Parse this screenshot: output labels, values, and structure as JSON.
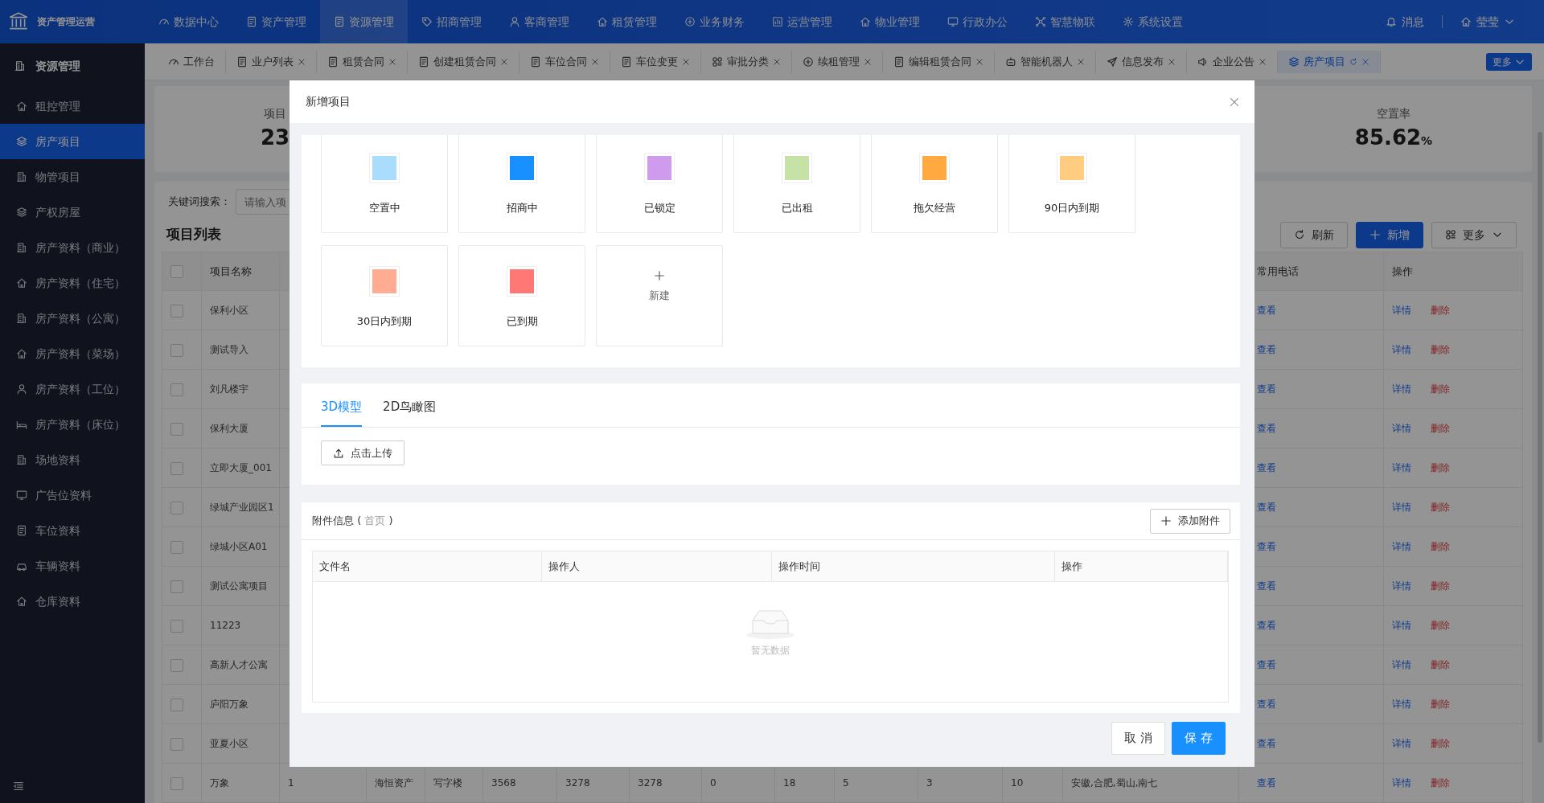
{
  "app": {
    "title": "资产管理运营"
  },
  "top_menu": [
    {
      "label": "数据中心",
      "selected": false
    },
    {
      "label": "资产管理",
      "selected": false
    },
    {
      "label": "资源管理",
      "selected": true
    },
    {
      "label": "招商管理",
      "selected": false
    },
    {
      "label": "客商管理",
      "selected": false
    },
    {
      "label": "租赁管理",
      "selected": false
    },
    {
      "label": "业务财务",
      "selected": false
    },
    {
      "label": "运营管理",
      "selected": false
    },
    {
      "label": "物业管理",
      "selected": false
    },
    {
      "label": "行政办公",
      "selected": false
    },
    {
      "label": "智慧物联",
      "selected": false
    },
    {
      "label": "系统设置",
      "selected": false
    }
  ],
  "header_right": {
    "messages": "消息",
    "user": "莹莹"
  },
  "sidebar": {
    "title": "资源管理",
    "items": [
      {
        "label": "租控管理",
        "selected": false
      },
      {
        "label": "房产项目",
        "selected": true
      },
      {
        "label": "物管项目",
        "selected": false
      },
      {
        "label": "产权房屋",
        "selected": false
      },
      {
        "label": "房产资料（商业）",
        "selected": false
      },
      {
        "label": "房产资料（住宅）",
        "selected": false
      },
      {
        "label": "房产资料（公寓）",
        "selected": false
      },
      {
        "label": "房产资料（菜场）",
        "selected": false
      },
      {
        "label": "房产资料（工位）",
        "selected": false
      },
      {
        "label": "房产资料（床位）",
        "selected": false
      },
      {
        "label": "场地资料",
        "selected": false
      },
      {
        "label": "广告位资料",
        "selected": false
      },
      {
        "label": "车位资料",
        "selected": false
      },
      {
        "label": "车辆资料",
        "selected": false
      },
      {
        "label": "仓库资料",
        "selected": false
      }
    ]
  },
  "tabs": [
    {
      "label": "工作台",
      "closable": false,
      "selected": false
    },
    {
      "label": "业户列表",
      "closable": true,
      "selected": false
    },
    {
      "label": "租赁合同",
      "closable": true,
      "selected": false
    },
    {
      "label": "创建租赁合同",
      "closable": true,
      "selected": false
    },
    {
      "label": "车位合同",
      "closable": true,
      "selected": false
    },
    {
      "label": "车位变更",
      "closable": true,
      "selected": false
    },
    {
      "label": "审批分类",
      "closable": true,
      "selected": false
    },
    {
      "label": "续租管理",
      "closable": true,
      "selected": false
    },
    {
      "label": "编辑租赁合同",
      "closable": true,
      "selected": false
    },
    {
      "label": "智能机器人",
      "closable": true,
      "selected": false
    },
    {
      "label": "信息发布",
      "closable": true,
      "selected": false
    },
    {
      "label": "企业公告",
      "closable": true,
      "selected": false
    },
    {
      "label": "房产项目",
      "closable": true,
      "selected": true
    }
  ],
  "tabs_more": "更多",
  "stats": [
    {
      "label": "项目",
      "value": "23"
    },
    {
      "label": "空置率",
      "value": "85.62",
      "unit": "%"
    }
  ],
  "search": {
    "label": "关键词搜索：",
    "placeholder": "请输入项"
  },
  "list": {
    "title": "项目列表",
    "buttons": [
      {
        "label": "刷新",
        "kind": "refresh"
      },
      {
        "label": "新增",
        "kind": "primary"
      },
      {
        "label": "更多",
        "kind": "more"
      }
    ]
  },
  "table": {
    "header_checked": false,
    "columns": [
      {
        "label": "项目名称"
      },
      {
        "label": "常用电话"
      },
      {
        "label": "操作"
      }
    ],
    "rows": [
      {
        "checked": false,
        "name": "保利小区",
        "link": "查看",
        "actions": [
          "详情",
          "删除"
        ]
      },
      {
        "checked": false,
        "name": "测试导入",
        "link": "查看",
        "actions": [
          "详情",
          "删除"
        ]
      },
      {
        "checked": false,
        "name": "刘凡楼宇",
        "link": "查看",
        "actions": [
          "详情",
          "删除"
        ]
      },
      {
        "checked": false,
        "name": "保利大厦",
        "link": "查看",
        "actions": [
          "详情",
          "删除"
        ]
      },
      {
        "checked": false,
        "name": "立即大厦_001",
        "link": "查看",
        "actions": [
          "详情",
          "删除"
        ]
      },
      {
        "checked": false,
        "name": "绿城产业园区1",
        "link": "查看",
        "actions": [
          "详情",
          "删除"
        ]
      },
      {
        "checked": false,
        "name": "绿城小区A01",
        "link": "查看",
        "actions": [
          "详情",
          "删除"
        ]
      },
      {
        "checked": false,
        "name": "测试公寓项目",
        "link": "查看",
        "actions": [
          "详情",
          "删除"
        ]
      },
      {
        "checked": false,
        "name": "11223",
        "link": "查看",
        "actions": [
          "详情",
          "删除"
        ]
      },
      {
        "checked": false,
        "name": "高新人才公寓",
        "link": "查看",
        "actions": [
          "详情",
          "删除"
        ]
      },
      {
        "checked": false,
        "name": "庐阳万象",
        "link": "查看",
        "actions": [
          "详情",
          "删除"
        ]
      },
      {
        "checked": false,
        "name": "亚夏小区",
        "link": "查看",
        "actions": [
          "详情",
          "删除"
        ]
      },
      {
        "checked": false,
        "name": "万象",
        "details": [
          "1",
          "海恒资产",
          "写字楼",
          "3568",
          "3278",
          "3278",
          "0",
          "18",
          "5",
          "3",
          "10",
          "安徽,合肥,蜀山,南七"
        ],
        "link": "查看",
        "actions": [
          "详情",
          "删除"
        ]
      }
    ]
  },
  "modal": {
    "title": "新增项目",
    "statuses": [
      {
        "kind": "status",
        "label": "空置中",
        "color": "#a9dcfd"
      },
      {
        "kind": "status",
        "label": "招商中",
        "color": "#1890ff"
      },
      {
        "kind": "status",
        "label": "已锁定",
        "color": "#cf9bed"
      },
      {
        "kind": "status",
        "label": "已出租",
        "color": "#c7e2a6"
      },
      {
        "kind": "status",
        "label": "拖欠经营",
        "color": "#ffa940"
      },
      {
        "kind": "status",
        "label": "90日内到期",
        "color": "#ffcc80"
      },
      {
        "kind": "status",
        "label": "30日内到期",
        "color": "#ffac93"
      },
      {
        "kind": "status",
        "label": "已到期",
        "color": "#ff7875"
      },
      {
        "kind": "add",
        "label": "新建"
      }
    ],
    "model_tabs": [
      {
        "label": "3D模型",
        "selected": true
      },
      {
        "label": "2D鸟瞰图",
        "selected": false
      }
    ],
    "upload": "点击上传",
    "attachments": {
      "title": "附件信息",
      "note": [
        "(",
        "首页",
        ")"
      ],
      "add": "添加附件",
      "columns": [
        "文件名",
        "操作人",
        "操作时间",
        "操作"
      ],
      "empty": "暂无数据"
    },
    "buttons": {
      "cancel": "取 消",
      "save": "保 存"
    }
  }
}
